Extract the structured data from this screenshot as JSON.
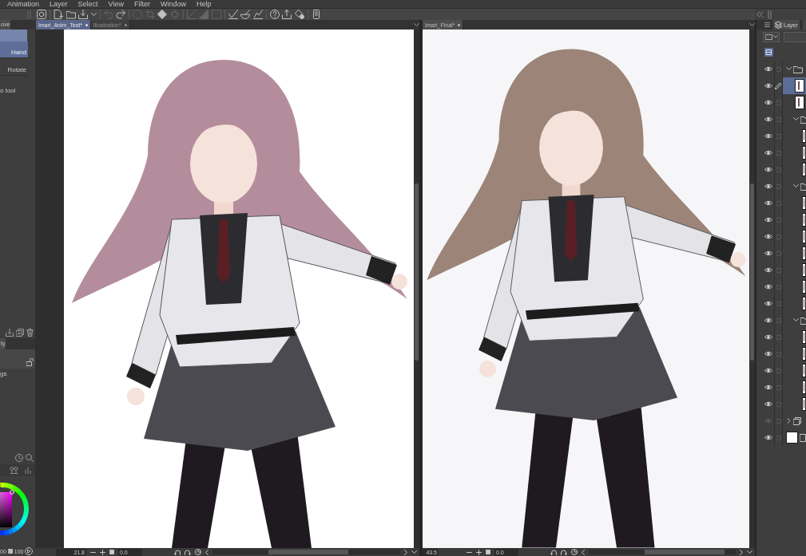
{
  "menu_bar": {
    "items": [
      "Animation",
      "Layer",
      "Select",
      "View",
      "Filter",
      "Window",
      "Help"
    ]
  },
  "toolbar": {
    "groups": [
      [
        {
          "kind": "app",
          "disabled": false
        }
      ],
      [
        {
          "kind": "new",
          "disabled": false
        },
        {
          "kind": "open",
          "disabled": false
        },
        {
          "kind": "save",
          "disabled": false
        },
        {
          "kind": "caret",
          "disabled": false
        }
      ],
      [
        {
          "kind": "undo",
          "disabled": true
        },
        {
          "kind": "redo",
          "disabled": false
        }
      ],
      [
        {
          "kind": "clear_selection",
          "disabled": true
        },
        {
          "kind": "crop_selection",
          "disabled": true
        },
        {
          "kind": "fill",
          "disabled": false
        },
        {
          "kind": "transform",
          "disabled": true
        }
      ],
      [
        {
          "kind": "ruler_line",
          "disabled": true
        },
        {
          "kind": "gradient",
          "disabled": true
        },
        {
          "kind": "grid",
          "disabled": true
        }
      ],
      [
        {
          "kind": "stroke_correct",
          "disabled": false
        },
        {
          "kind": "ink",
          "disabled": false
        },
        {
          "kind": "stroke_check",
          "disabled": false
        }
      ],
      [
        {
          "kind": "help",
          "disabled": false
        },
        {
          "kind": "export",
          "disabled": false
        },
        {
          "kind": "assets",
          "disabled": false
        }
      ],
      [
        {
          "kind": "device",
          "disabled": false
        }
      ]
    ]
  },
  "tool_panel": {
    "tab": "ove",
    "subtools": [
      {
        "label": "Hand",
        "selected": true
      },
      {
        "label": "Rotate",
        "selected": false
      }
    ],
    "hint": "o tool"
  },
  "property_panel": {
    "tab": "ty",
    "label": "gs"
  },
  "color_panel": {
    "readouts": [
      "00",
      "100"
    ]
  },
  "canvas_panes": [
    {
      "focused": true,
      "tabs": [
        {
          "label": "Imari_Anim_Test*",
          "selected": true
        },
        {
          "label": "Illustration*",
          "selected": false
        }
      ],
      "status": {
        "zoom": "21.8",
        "rotation": "0.0"
      }
    },
    {
      "focused": false,
      "tabs": [
        {
          "label": "Imari_Final*",
          "selected": true
        }
      ],
      "status": {
        "zoom": "43.5",
        "rotation": "0.0"
      }
    }
  ],
  "layer_panel": {
    "tab": "Layer",
    "layers": [
      {
        "kind": "folder",
        "visible": true,
        "selected": false,
        "editing": false,
        "expanded": true,
        "children": [
          {
            "kind": "raster",
            "visible": true,
            "selected": true,
            "editing": true
          },
          {
            "kind": "raster",
            "visible": true,
            "selected": false,
            "editing": false
          },
          {
            "kind": "folder",
            "visible": true,
            "selected": false,
            "editing": false,
            "expanded": true,
            "children": [
              {
                "kind": "raster",
                "visible": true,
                "selected": false,
                "editing": false
              },
              {
                "kind": "raster",
                "visible": true,
                "selected": false,
                "editing": false
              },
              {
                "kind": "raster",
                "visible": true,
                "selected": false,
                "editing": false
              }
            ]
          },
          {
            "kind": "folder",
            "visible": true,
            "selected": false,
            "editing": false,
            "expanded": true,
            "children": [
              {
                "kind": "raster",
                "visible": true,
                "selected": false,
                "editing": false
              },
              {
                "kind": "raster",
                "visible": true,
                "selected": false,
                "editing": false
              },
              {
                "kind": "raster",
                "visible": true,
                "selected": false,
                "editing": false
              },
              {
                "kind": "raster",
                "visible": true,
                "selected": false,
                "editing": false
              },
              {
                "kind": "raster",
                "visible": true,
                "selected": false,
                "editing": false
              },
              {
                "kind": "raster",
                "visible": true,
                "selected": false,
                "editing": false
              },
              {
                "kind": "raster",
                "visible": true,
                "selected": false,
                "editing": false
              }
            ]
          },
          {
            "kind": "folder",
            "visible": true,
            "selected": false,
            "editing": false,
            "expanded": true,
            "children": [
              {
                "kind": "raster",
                "visible": true,
                "selected": false,
                "editing": false
              },
              {
                "kind": "raster",
                "visible": true,
                "selected": false,
                "editing": false
              },
              {
                "kind": "raster",
                "visible": true,
                "selected": false,
                "editing": false
              },
              {
                "kind": "raster",
                "visible": true,
                "selected": false,
                "editing": false
              },
              {
                "kind": "raster",
                "visible": true,
                "selected": false,
                "editing": false
              }
            ]
          }
        ]
      },
      {
        "kind": "animation_folder",
        "visible": false,
        "selected": false,
        "editing": false,
        "expanded": false
      },
      {
        "kind": "paper",
        "visible": true,
        "selected": false,
        "editing": false
      }
    ]
  }
}
